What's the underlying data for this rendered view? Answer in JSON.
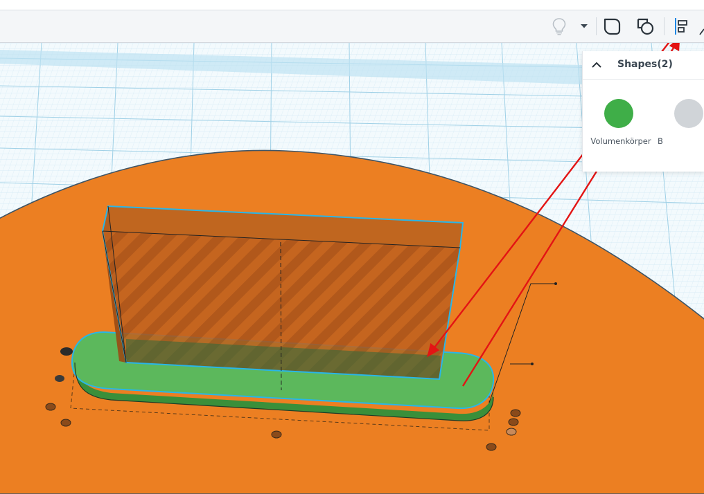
{
  "toolbar": {
    "icons": [
      "lightbulb-icon",
      "chevron-down-icon",
      "group-icon",
      "ungroup-icon",
      "align-icon",
      "flip-icon"
    ]
  },
  "shapes_panel": {
    "title": "Shapes",
    "count": "(2)",
    "items": [
      {
        "label": "Volumenkörper",
        "color": "#3fae48"
      },
      {
        "label": "B"
      }
    ]
  },
  "colors": {
    "workplane": "#ec7f22",
    "selection_outline": "#29b6e8",
    "annotation_arrow": "#e31414",
    "solid_shape": "#5cb85c",
    "hole_shape": "#b55a1e"
  }
}
